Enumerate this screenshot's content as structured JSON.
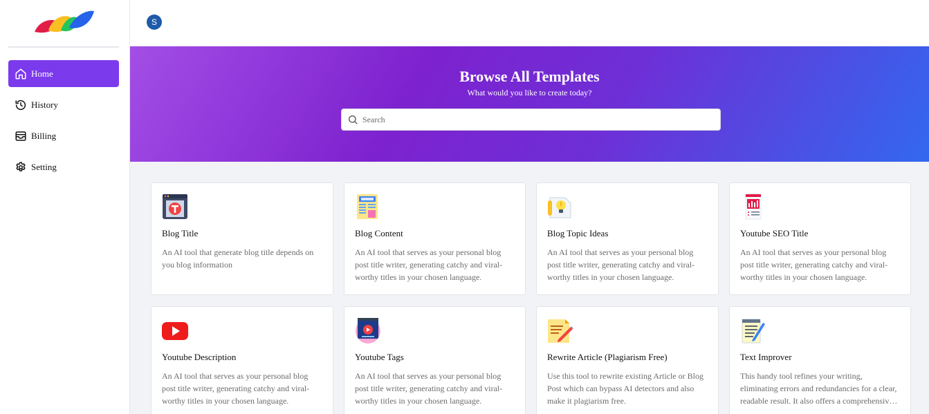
{
  "sidebar": {
    "items": [
      {
        "label": "Home",
        "icon": "home-icon",
        "active": true
      },
      {
        "label": "History",
        "icon": "history-icon",
        "active": false
      },
      {
        "label": "Billing",
        "icon": "wallet-icon",
        "active": false
      },
      {
        "label": "Setting",
        "icon": "gear-icon",
        "active": false
      }
    ]
  },
  "topbar": {
    "avatar_initial": "S"
  },
  "hero": {
    "title": "Browse All Templates",
    "subtitle": "What would you like to create today?",
    "search_placeholder": "Search"
  },
  "colors": {
    "accent": "#7c3aed",
    "hero_start": "#a34ee6",
    "hero_end": "#3268ef"
  },
  "templates": [
    {
      "title": "Blog Title",
      "desc": "An AI tool that generate blog title depends on you blog information",
      "icon": "blog-title-icon"
    },
    {
      "title": "Blog Content",
      "desc": "An AI tool that serves as your personal blog post title writer, generating catchy and viral-worthy titles in your chosen language.",
      "icon": "blog-content-icon"
    },
    {
      "title": "Blog Topic Ideas",
      "desc": "An AI tool that serves as your personal blog post title writer, generating catchy and viral-worthy titles in your chosen language.",
      "icon": "lightbulb-icon"
    },
    {
      "title": "Youtube SEO Title",
      "desc": "An AI tool that serves as your personal blog post title writer, generating catchy and viral-worthy titles in your chosen language.",
      "icon": "seo-report-icon"
    },
    {
      "title": "Youtube Description",
      "desc": "An AI tool that serves as your personal blog post title writer, generating catchy and viral-worthy titles in your chosen language.",
      "icon": "youtube-icon"
    },
    {
      "title": "Youtube Tags",
      "desc": "An AI tool that serves as your personal blog post title writer, generating catchy and viral-worthy titles in your chosen language.",
      "icon": "video-tags-icon"
    },
    {
      "title": "Rewrite Article (Plagiarism Free)",
      "desc": "Use this tool to rewrite existing Article or Blog Post which can bypass AI detectors and also make it plagiarism free.",
      "icon": "rewrite-icon"
    },
    {
      "title": "Text Improver",
      "desc": "This handy tool refines your writing, eliminating errors and redundancies for a clear, readable result. It also offers a comprehensive tone analysis and suggests better word choices.",
      "icon": "notepad-icon"
    }
  ]
}
